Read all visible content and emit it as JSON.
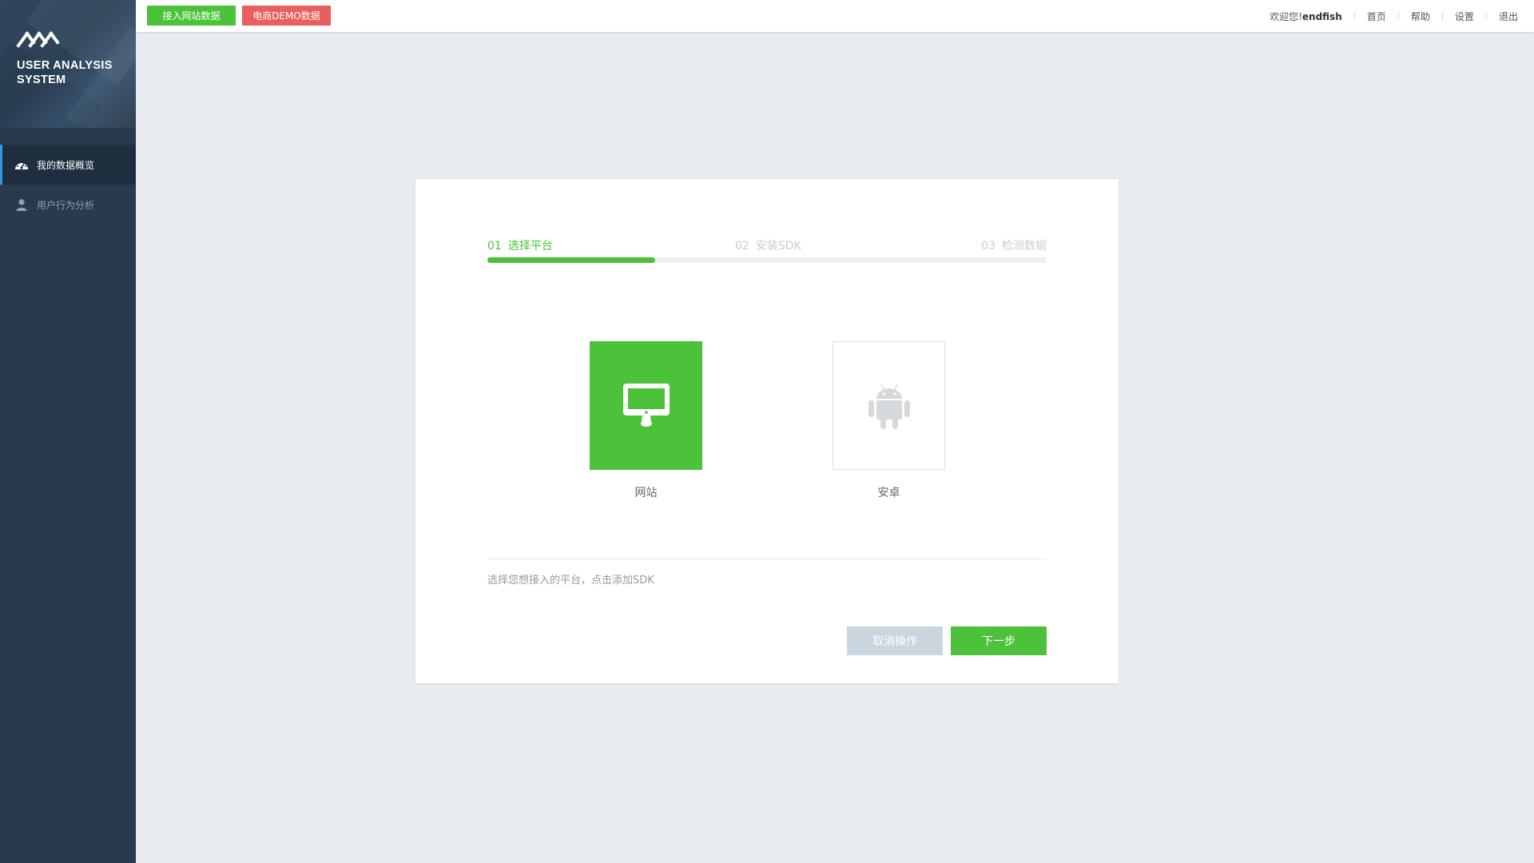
{
  "brand": {
    "title": "USER ANALYSIS SYSTEM",
    "logo_icon": "brand-logo-icon"
  },
  "sidebar": {
    "items": [
      {
        "label": "我的数据概览",
        "icon": "dashboard-icon",
        "active": true
      },
      {
        "label": "用户行为分析",
        "icon": "user-icon",
        "active": false
      }
    ]
  },
  "header": {
    "buttons": [
      {
        "label": "接入网站数据",
        "color": "#4cc23a"
      },
      {
        "label": "电商DEMO数据",
        "color": "#e95e5e"
      }
    ],
    "welcome_prefix": "欢迎您!",
    "username": "endfish",
    "links": [
      "首页",
      "帮助",
      "设置",
      "退出"
    ],
    "separator": "|"
  },
  "wizard": {
    "steps": [
      {
        "num": "01",
        "label": "选择平台",
        "active": true
      },
      {
        "num": "02",
        "label": "安装SDK",
        "active": false
      },
      {
        "num": "03",
        "label": "检测数据",
        "active": false
      }
    ],
    "progress": 0.3,
    "platforms": [
      {
        "label": "网站",
        "icon": "monitor-icon",
        "selected": true
      },
      {
        "label": "安卓",
        "icon": "android-icon",
        "selected": false
      }
    ],
    "hint": "选择您想接入的平台，点击添加SDK",
    "cancel_label": "取消操作",
    "next_label": "下一步"
  },
  "colors": {
    "accent": "#4cc23a",
    "danger": "#e95e5e",
    "sidebar": "#283a4d",
    "active_indicator": "#2f9ae0"
  }
}
